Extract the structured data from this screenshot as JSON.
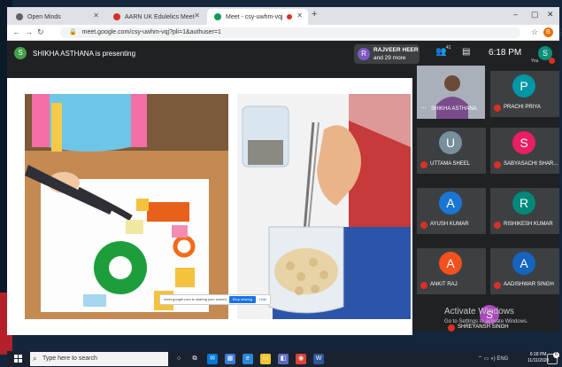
{
  "browser": {
    "tabs": [
      {
        "title": "Open Minds",
        "favicon_color": "#5f6368"
      },
      {
        "title": "AARN UK Edulelics Meet",
        "favicon_color": "#d93025"
      },
      {
        "title": "Meet - csy-uwhm-vqj",
        "favicon_color": "#0f9d58"
      }
    ],
    "new_tab_label": "+",
    "window_controls": {
      "minimize": "–",
      "maximize": "▢",
      "close": "✕"
    },
    "url": "meet.google.com/csy-uwhm-vqj?pli=1&authuser=1",
    "profile_initial": "B"
  },
  "meet": {
    "presenting_banner": "SHIKHA ASTHANA is presenting",
    "presenter_initial": "S",
    "participants_pill": {
      "initial": "R",
      "name": "RAJVEER HEER",
      "more": "and 29 more"
    },
    "participant_count": "41",
    "clock": "6:18 PM",
    "self": {
      "initial": "S",
      "label": "You"
    },
    "share_bar": {
      "text": "meet.google.com is sharing your screen.",
      "stop": "Stop sharing",
      "hide": "Hide"
    },
    "presenter_tile_name": "SHIKHA ASTHANA",
    "participants": [
      {
        "initial": "P",
        "name": "PRACHI PRIYA",
        "color": "#0097a7"
      },
      {
        "initial": "U",
        "name": "UTTAMA SHEEL",
        "color": "#78909c"
      },
      {
        "initial": "S",
        "name": "SABYASACHI SHAR...",
        "color": "#e91e63"
      },
      {
        "initial": "A",
        "name": "AYUSH KUMAR",
        "color": "#1976d2"
      },
      {
        "initial": "R",
        "name": "RISHIKESH KUMAR",
        "color": "#00897b"
      },
      {
        "initial": "A",
        "name": "ANKIT RAJ",
        "color": "#f4511e"
      },
      {
        "initial": "A",
        "name": "AADISHWAR SINGH",
        "color": "#1565c0"
      },
      {
        "initial": "S",
        "name": "SHREYANSH SINGH",
        "color": "#ab47bc"
      }
    ],
    "watermark": {
      "title": "Activate Windows",
      "subtitle": "Go to Settings to activate Windows."
    }
  },
  "taskbar": {
    "search_placeholder": "Type here to search",
    "time": "6:18 PM",
    "date": "11/11/2020",
    "notification_count": "6"
  },
  "colors": {
    "meet_bg": "#202124",
    "tile_bg": "#3c4043",
    "mute_red": "#d93025",
    "share_blue": "#1a73e8"
  }
}
